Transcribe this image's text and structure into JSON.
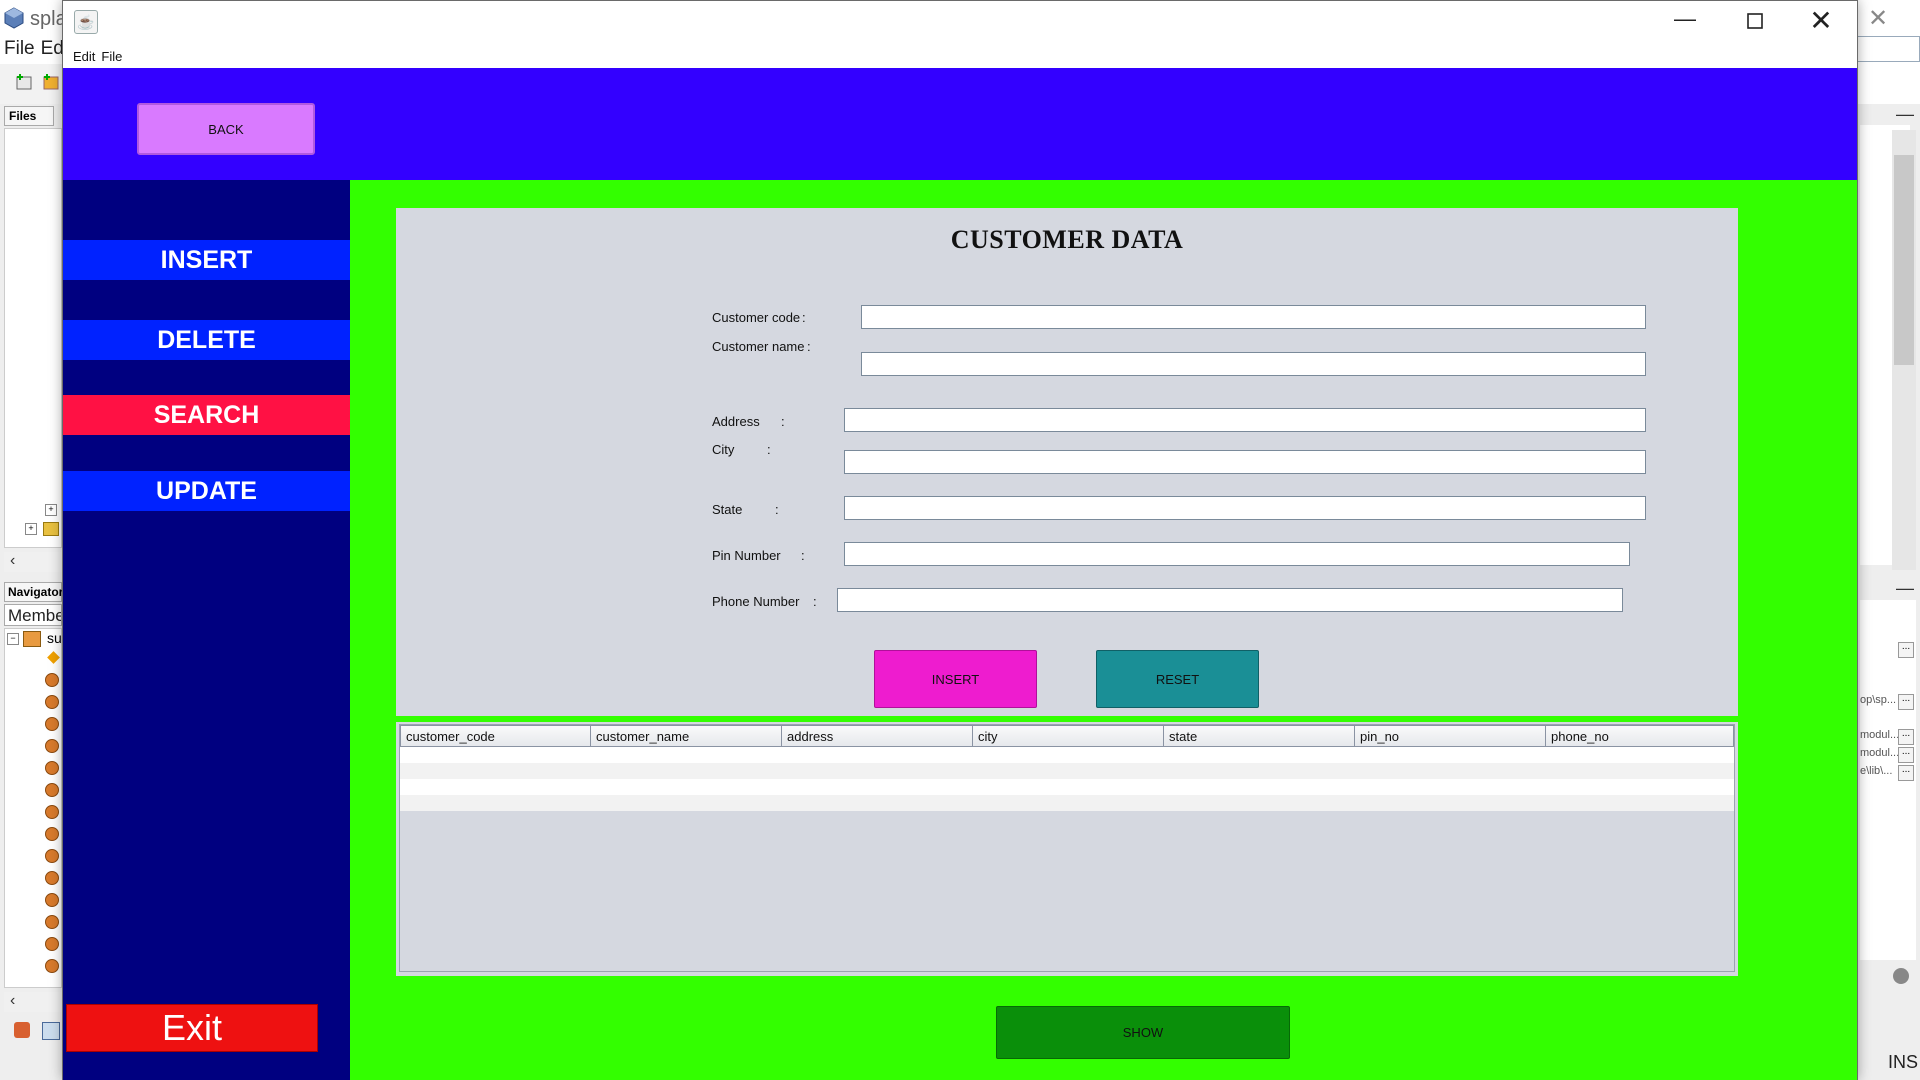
{
  "ide": {
    "title_partial": "spla",
    "menu": [
      "File",
      "Edi"
    ],
    "files_tab": "Files",
    "navigator_tab": "Navigator",
    "members_label": "Member",
    "node_label": "su",
    "status": "INS",
    "right_props": [
      "op\\sp...",
      "modul...",
      "modul...",
      "e\\lib\\..."
    ]
  },
  "window": {
    "menu": [
      "Edit",
      "File"
    ]
  },
  "header": {
    "back_label": "BACK"
  },
  "sidebar": {
    "items": [
      "INSERT",
      "DELETE",
      "SEARCH",
      "UPDATE"
    ],
    "exit_label": "Exit"
  },
  "form": {
    "title": "CUSTOMER DATA",
    "fields": [
      {
        "label": "Customer code",
        "value": ""
      },
      {
        "label": "Customer name",
        "value": ""
      },
      {
        "label": "Address",
        "value": ""
      },
      {
        "label": "City",
        "value": ""
      },
      {
        "label": "State",
        "value": ""
      },
      {
        "label": "Pin Number",
        "value": ""
      },
      {
        "label": "Phone Number",
        "value": ""
      }
    ],
    "colon": ":",
    "insert_label": "INSERT",
    "reset_label": "RESET"
  },
  "table": {
    "columns": [
      "customer_code",
      "customer_name",
      "address",
      "city",
      "state",
      "pin_no",
      "phone_no"
    ]
  },
  "show_label": "SHOW",
  "colors": {
    "header_bg": "#3300ff",
    "sidebar_bg": "#000080",
    "sidebar_btn": "#0022ff",
    "sidebar_btn_active": "#ff1144",
    "main_bg": "#33ff00",
    "panel_bg": "#d5d8e0",
    "back_btn": "#d97aff",
    "insert_btn": "#ee1ccf",
    "reset_btn": "#1a8f96",
    "show_btn": "#0a8f0a",
    "exit_btn": "#ee1111"
  }
}
